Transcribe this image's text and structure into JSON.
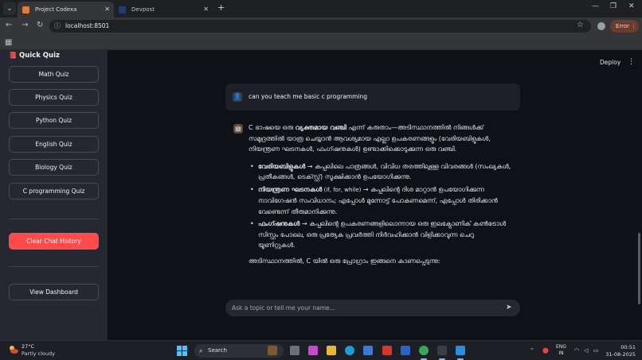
{
  "browser": {
    "tabs": [
      {
        "title": "Project Codexa",
        "active": true
      },
      {
        "title": "Devpost",
        "active": false
      }
    ],
    "url": "localhost:8501",
    "error_label": "Error"
  },
  "sidebar": {
    "title": "Quick Quiz",
    "quiz_buttons": [
      "Math Quiz",
      "Physics Quiz",
      "Python Quiz",
      "English Quiz",
      "Biology Quiz",
      "C programming Quiz"
    ],
    "clear_label": "Clear Chat History",
    "dashboard_label": "View Dashboard"
  },
  "header": {
    "deploy_label": "Deploy"
  },
  "chat": {
    "user_message": "can you teach me basic c programming",
    "assistant": {
      "intro_plain1": "C ഭാഷയെ ഒരു ",
      "intro_bold": "വ്യക്തമായ വഞ്ചി",
      "intro_plain2": " എന്ന് കരുതാം—അടിസ്ഥാനത്തിൽ നിങ്ങൾക്ക് സമുദ്രത്തിൽ യാത്ര ചെയ്യാൻ ആവശ്യമായ എല്ലാ ഉപകരണങ്ങളും (വേരിയബിളുകൾ, നിയന്ത്രണ ഘടനകൾ, ഫംഗ്ഷനുകൾ) ഉണ്ടാക്കിക്കൊടുക്കുന്ന ഒരു വഞ്ചി.",
      "bullets": [
        {
          "title": "വേരിയബിളുകൾ",
          "extra": "",
          "text": " → കപ്പലിലെ പാത്രങ്ങൾ, വിവിധ തരത്തിലുള്ള വിവരങ്ങൾ (സംഖ്യകൾ, പ്രതീകങ്ങൾ, ടെക്സ്റ്റ്) സൂക്ഷിക്കാൻ ഉപയോഗിക്കുന്നു."
        },
        {
          "title": "നിയന്ത്രണ ഘടനകൾ",
          "extra": " (if, for, while)",
          "text": " → കപ്പലിന്റെ ദിശ മാറ്റാൻ ഉപയോഗിക്കുന്ന നാവിഗേഷൻ സംവിധാനം; എപ്പോൾ മുന്നോട്ട് പോകണമെന്ന്, എപ്പോൾ തിരിക്കാൻ വേണ്ടെന്ന് തീരുമാനിക്കുന്നു."
        },
        {
          "title": "ഫംഗ്ഷനുകൾ",
          "extra": "",
          "text": " → കപ്പലിന്റെ ഉപകരണങ്ങളിലൊന്നായ ഒരു ഇലക്ട്രോണിക് കൺട്രോൾ സിസ്റ്റം പോലെ, ഒരു പ്രത്യേക പ്രവർത്തി നിർവഹിക്കാൻ വിളിക്കാവുന്ന ചെറു യൂണിറ്റുകൾ."
        }
      ],
      "outro": "അടിസ്ഥാനത്തിൽ, C യിൽ ഒരു പ്രോഗ്രാം ഇങ്ങനെ കാണപ്പെടുന്നു:"
    },
    "input_placeholder": "Ask a topic or tell me your name..."
  },
  "taskbar": {
    "weather_temp": "27°C",
    "weather_desc": "Partly cloudy",
    "search_label": "Search",
    "lang_line1": "ENG",
    "lang_line2": "IN",
    "time": "00:51",
    "date": "31-08-2025"
  }
}
